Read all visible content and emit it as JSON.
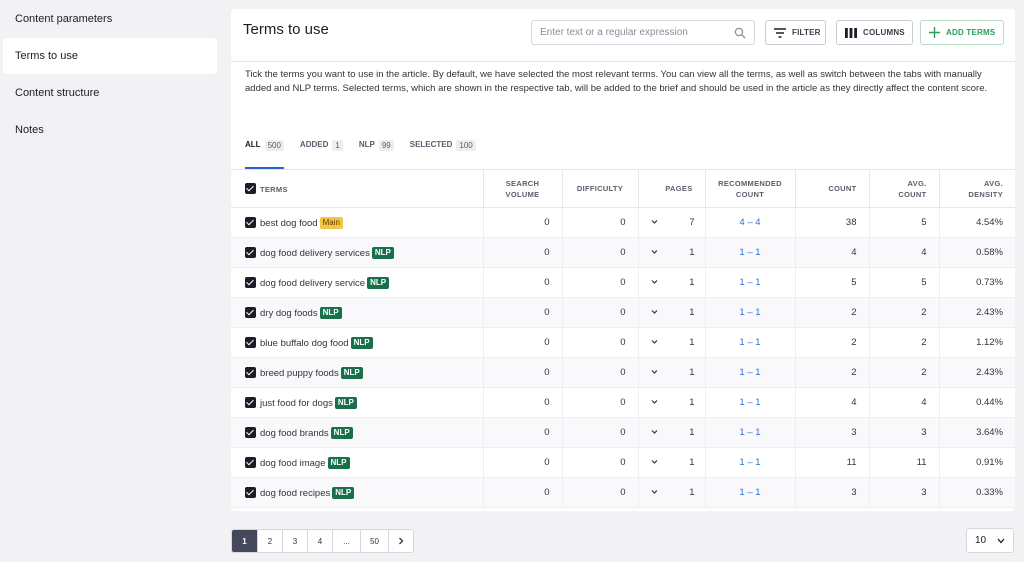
{
  "sidebar": {
    "items": [
      {
        "label": "Content parameters"
      },
      {
        "label": "Terms to use"
      },
      {
        "label": "Content structure"
      },
      {
        "label": "Notes"
      }
    ]
  },
  "panel": {
    "title": "Terms to use",
    "search_placeholder": "Enter text or a regular expression",
    "filter_label": "FILTER",
    "columns_label": "COLUMNS",
    "add_terms_label": "ADD TERMS",
    "description": "Tick the terms you want to use in the article. By default, we have selected the most relevant terms. You can view all the terms, as well as switch between the tabs with manually added and NLP terms. Selected terms, which are shown in the respective tab, will be added to the brief and should be used in the article as they directly affect the content score."
  },
  "tabs": [
    {
      "label": "ALL",
      "count": "500"
    },
    {
      "label": "ADDED",
      "count": "1"
    },
    {
      "label": "NLP",
      "count": "99"
    },
    {
      "label": "SELECTED",
      "count": "100"
    }
  ],
  "table": {
    "headers": {
      "terms": "TERMS",
      "search_volume_1": "SEARCH",
      "search_volume_2": "VOLUME",
      "difficulty": "DIFFICULTY",
      "pages": "PAGES",
      "recommended_1": "RECOMMENDED",
      "recommended_2": "COUNT",
      "count": "COUNT",
      "avg_count_1": "AVG.",
      "avg_count_2": "COUNT",
      "avg_density_1": "AVG.",
      "avg_density_2": "DENSITY"
    },
    "rows": [
      {
        "term": "best dog food",
        "badge": "Main",
        "search_volume": "0",
        "difficulty": "0",
        "pages": "7",
        "recommended": "4 – 4",
        "count": "38",
        "avg_count": "5",
        "avg_density": "4.54%"
      },
      {
        "term": "dog food delivery services",
        "badge": "NLP",
        "search_volume": "0",
        "difficulty": "0",
        "pages": "1",
        "recommended": "1 – 1",
        "count": "4",
        "avg_count": "4",
        "avg_density": "0.58%"
      },
      {
        "term": "dog food delivery service",
        "badge": "NLP",
        "search_volume": "0",
        "difficulty": "0",
        "pages": "1",
        "recommended": "1 – 1",
        "count": "5",
        "avg_count": "5",
        "avg_density": "0.73%"
      },
      {
        "term": "dry dog foods",
        "badge": "NLP",
        "search_volume": "0",
        "difficulty": "0",
        "pages": "1",
        "recommended": "1 – 1",
        "count": "2",
        "avg_count": "2",
        "avg_density": "2.43%"
      },
      {
        "term": "blue buffalo dog food",
        "badge": "NLP",
        "search_volume": "0",
        "difficulty": "0",
        "pages": "1",
        "recommended": "1 – 1",
        "count": "2",
        "avg_count": "2",
        "avg_density": "1.12%"
      },
      {
        "term": "breed puppy foods",
        "badge": "NLP",
        "search_volume": "0",
        "difficulty": "0",
        "pages": "1",
        "recommended": "1 – 1",
        "count": "2",
        "avg_count": "2",
        "avg_density": "2.43%"
      },
      {
        "term": "just food for dogs",
        "badge": "NLP",
        "search_volume": "0",
        "difficulty": "0",
        "pages": "1",
        "recommended": "1 – 1",
        "count": "4",
        "avg_count": "4",
        "avg_density": "0.44%"
      },
      {
        "term": "dog food brands",
        "badge": "NLP",
        "search_volume": "0",
        "difficulty": "0",
        "pages": "1",
        "recommended": "1 – 1",
        "count": "3",
        "avg_count": "3",
        "avg_density": "3.64%"
      },
      {
        "term": "dog food image",
        "badge": "NLP",
        "search_volume": "0",
        "difficulty": "0",
        "pages": "1",
        "recommended": "1 – 1",
        "count": "11",
        "avg_count": "11",
        "avg_density": "0.91%"
      },
      {
        "term": "dog food recipes",
        "badge": "NLP",
        "search_volume": "0",
        "difficulty": "0",
        "pages": "1",
        "recommended": "1 – 1",
        "count": "3",
        "avg_count": "3",
        "avg_density": "0.33%"
      }
    ]
  },
  "pagination": {
    "pages": [
      "1",
      "2",
      "3",
      "4",
      "...",
      "50"
    ],
    "current": "1",
    "per_page": "10"
  },
  "colors": {
    "accent_blue": "#2b5fd9",
    "nlp_badge": "#17704a",
    "main_badge": "#f6c544",
    "add_green": "#2a9d5c"
  }
}
